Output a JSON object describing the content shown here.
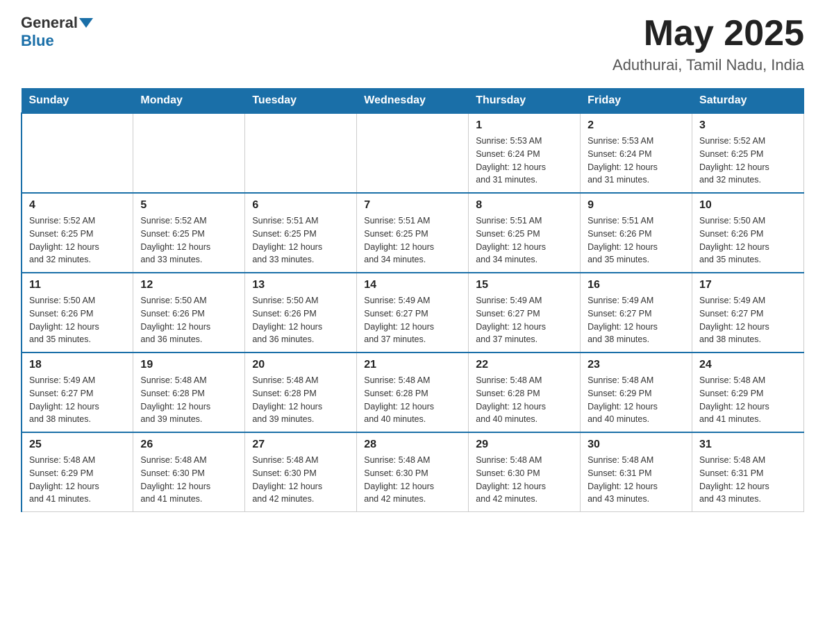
{
  "header": {
    "logo": {
      "general": "General",
      "blue": "Blue"
    },
    "title": "May 2025",
    "location": "Aduthurai, Tamil Nadu, India"
  },
  "calendar": {
    "days_of_week": [
      "Sunday",
      "Monday",
      "Tuesday",
      "Wednesday",
      "Thursday",
      "Friday",
      "Saturday"
    ],
    "weeks": [
      {
        "days": [
          {
            "number": "",
            "info": ""
          },
          {
            "number": "",
            "info": ""
          },
          {
            "number": "",
            "info": ""
          },
          {
            "number": "",
            "info": ""
          },
          {
            "number": "1",
            "info": "Sunrise: 5:53 AM\nSunset: 6:24 PM\nDaylight: 12 hours\nand 31 minutes."
          },
          {
            "number": "2",
            "info": "Sunrise: 5:53 AM\nSunset: 6:24 PM\nDaylight: 12 hours\nand 31 minutes."
          },
          {
            "number": "3",
            "info": "Sunrise: 5:52 AM\nSunset: 6:25 PM\nDaylight: 12 hours\nand 32 minutes."
          }
        ]
      },
      {
        "days": [
          {
            "number": "4",
            "info": "Sunrise: 5:52 AM\nSunset: 6:25 PM\nDaylight: 12 hours\nand 32 minutes."
          },
          {
            "number": "5",
            "info": "Sunrise: 5:52 AM\nSunset: 6:25 PM\nDaylight: 12 hours\nand 33 minutes."
          },
          {
            "number": "6",
            "info": "Sunrise: 5:51 AM\nSunset: 6:25 PM\nDaylight: 12 hours\nand 33 minutes."
          },
          {
            "number": "7",
            "info": "Sunrise: 5:51 AM\nSunset: 6:25 PM\nDaylight: 12 hours\nand 34 minutes."
          },
          {
            "number": "8",
            "info": "Sunrise: 5:51 AM\nSunset: 6:25 PM\nDaylight: 12 hours\nand 34 minutes."
          },
          {
            "number": "9",
            "info": "Sunrise: 5:51 AM\nSunset: 6:26 PM\nDaylight: 12 hours\nand 35 minutes."
          },
          {
            "number": "10",
            "info": "Sunrise: 5:50 AM\nSunset: 6:26 PM\nDaylight: 12 hours\nand 35 minutes."
          }
        ]
      },
      {
        "days": [
          {
            "number": "11",
            "info": "Sunrise: 5:50 AM\nSunset: 6:26 PM\nDaylight: 12 hours\nand 35 minutes."
          },
          {
            "number": "12",
            "info": "Sunrise: 5:50 AM\nSunset: 6:26 PM\nDaylight: 12 hours\nand 36 minutes."
          },
          {
            "number": "13",
            "info": "Sunrise: 5:50 AM\nSunset: 6:26 PM\nDaylight: 12 hours\nand 36 minutes."
          },
          {
            "number": "14",
            "info": "Sunrise: 5:49 AM\nSunset: 6:27 PM\nDaylight: 12 hours\nand 37 minutes."
          },
          {
            "number": "15",
            "info": "Sunrise: 5:49 AM\nSunset: 6:27 PM\nDaylight: 12 hours\nand 37 minutes."
          },
          {
            "number": "16",
            "info": "Sunrise: 5:49 AM\nSunset: 6:27 PM\nDaylight: 12 hours\nand 38 minutes."
          },
          {
            "number": "17",
            "info": "Sunrise: 5:49 AM\nSunset: 6:27 PM\nDaylight: 12 hours\nand 38 minutes."
          }
        ]
      },
      {
        "days": [
          {
            "number": "18",
            "info": "Sunrise: 5:49 AM\nSunset: 6:27 PM\nDaylight: 12 hours\nand 38 minutes."
          },
          {
            "number": "19",
            "info": "Sunrise: 5:48 AM\nSunset: 6:28 PM\nDaylight: 12 hours\nand 39 minutes."
          },
          {
            "number": "20",
            "info": "Sunrise: 5:48 AM\nSunset: 6:28 PM\nDaylight: 12 hours\nand 39 minutes."
          },
          {
            "number": "21",
            "info": "Sunrise: 5:48 AM\nSunset: 6:28 PM\nDaylight: 12 hours\nand 40 minutes."
          },
          {
            "number": "22",
            "info": "Sunrise: 5:48 AM\nSunset: 6:28 PM\nDaylight: 12 hours\nand 40 minutes."
          },
          {
            "number": "23",
            "info": "Sunrise: 5:48 AM\nSunset: 6:29 PM\nDaylight: 12 hours\nand 40 minutes."
          },
          {
            "number": "24",
            "info": "Sunrise: 5:48 AM\nSunset: 6:29 PM\nDaylight: 12 hours\nand 41 minutes."
          }
        ]
      },
      {
        "days": [
          {
            "number": "25",
            "info": "Sunrise: 5:48 AM\nSunset: 6:29 PM\nDaylight: 12 hours\nand 41 minutes."
          },
          {
            "number": "26",
            "info": "Sunrise: 5:48 AM\nSunset: 6:30 PM\nDaylight: 12 hours\nand 41 minutes."
          },
          {
            "number": "27",
            "info": "Sunrise: 5:48 AM\nSunset: 6:30 PM\nDaylight: 12 hours\nand 42 minutes."
          },
          {
            "number": "28",
            "info": "Sunrise: 5:48 AM\nSunset: 6:30 PM\nDaylight: 12 hours\nand 42 minutes."
          },
          {
            "number": "29",
            "info": "Sunrise: 5:48 AM\nSunset: 6:30 PM\nDaylight: 12 hours\nand 42 minutes."
          },
          {
            "number": "30",
            "info": "Sunrise: 5:48 AM\nSunset: 6:31 PM\nDaylight: 12 hours\nand 43 minutes."
          },
          {
            "number": "31",
            "info": "Sunrise: 5:48 AM\nSunset: 6:31 PM\nDaylight: 12 hours\nand 43 minutes."
          }
        ]
      }
    ]
  }
}
